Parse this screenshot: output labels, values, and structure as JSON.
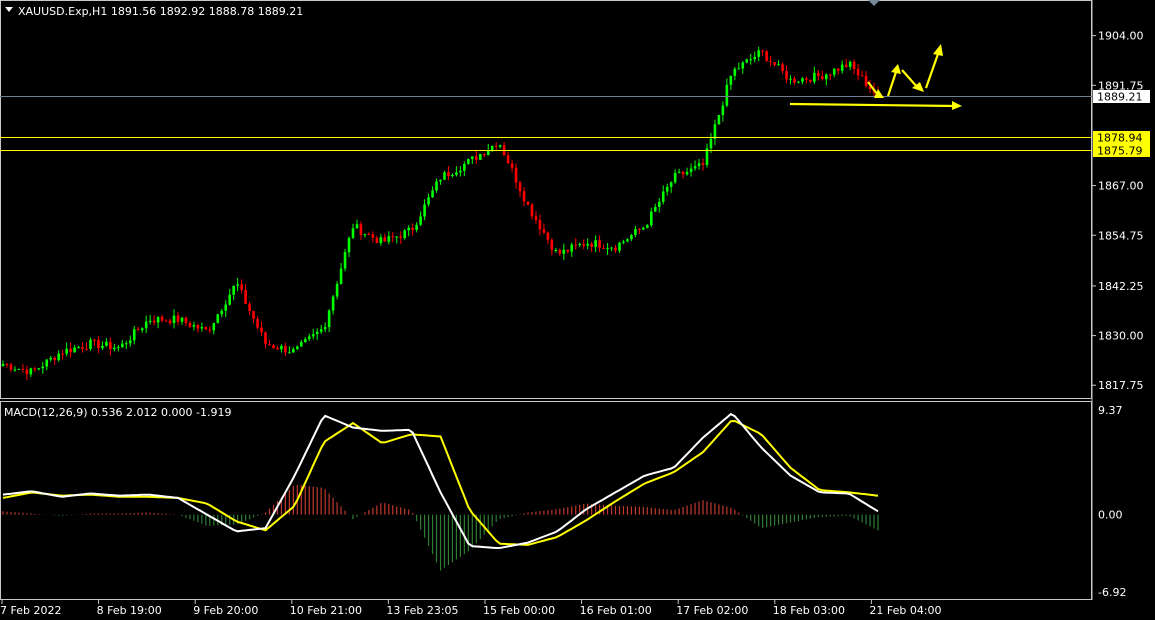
{
  "header": {
    "symbol_line": "XAUUSD.Exp,H1  1891.56 1892.92 1888.78 1889.21",
    "menu_icon": "triangle-down-icon"
  },
  "colors": {
    "background": "#000000",
    "bull": "#00ff00",
    "bear": "#ff0000",
    "level_line": "#ffff00",
    "current_price_line": "#708090",
    "signal_line": "#ffff00",
    "macd_line": "#ffffff",
    "hist_positive": "#c0392b",
    "hist_negative": "#2e7d32",
    "arrow": "#ffff00"
  },
  "chart_data": [
    {
      "type": "candlestick",
      "title": "XAUUSD.Exp,H1",
      "ohlc_last": {
        "open": 1891.56,
        "high": 1892.92,
        "low": 1888.78,
        "close": 1889.21
      },
      "price_ticks": [
        "1904.00",
        "1891.75",
        "1867.00",
        "1854.75",
        "1842.25",
        "1830.00",
        "1817.75"
      ],
      "ylim": [
        1814.6,
        1912.3
      ],
      "levels": [
        {
          "label": "1889.21",
          "value": 1889.21,
          "kind": "current"
        },
        {
          "label": "1878.94",
          "value": 1878.94,
          "kind": "resistance"
        },
        {
          "label": "1875.79",
          "value": 1875.79,
          "kind": "resistance"
        }
      ],
      "x_labels": [
        "7 Feb 2022",
        "8 Feb 19:00",
        "9 Feb 20:00",
        "10 Feb 21:00",
        "13 Feb 23:05",
        "15 Feb 00:00",
        "16 Feb 01:00",
        "17 Feb 02:00",
        "18 Feb 03:00",
        "21 Feb 04:00"
      ],
      "closes_sampled": [
        1823,
        1821,
        1826,
        1828,
        1827,
        1834,
        1834,
        1831,
        1843,
        1828,
        1826,
        1832,
        1857,
        1853,
        1856,
        1869,
        1873,
        1878,
        1862,
        1850,
        1853,
        1852,
        1857,
        1869,
        1872,
        1895,
        1900,
        1893,
        1894,
        1897,
        1889
      ],
      "annotations": "projection arrows drawn in yellow"
    },
    {
      "type": "line",
      "title": "MACD(12,26,9) 0.536 2.012 0.000 -1.919",
      "ticks": [
        "9.37",
        "0.00",
        "-6.92"
      ],
      "ylim": [
        -6.92,
        9.37
      ],
      "series": [
        {
          "name": "MACD",
          "values": [
            1.8,
            2.1,
            1.6,
            1.9,
            1.7,
            1.8,
            1.5,
            0.0,
            -1.5,
            -1.2,
            3.5,
            8.9,
            7.8,
            7.5,
            7.6,
            2.0,
            -2.8,
            -3.0,
            -2.5,
            -1.5,
            0.5,
            2.0,
            3.5,
            4.2,
            6.9,
            9.1,
            6.0,
            3.5,
            2.0,
            1.9,
            0.3
          ]
        },
        {
          "name": "Signal",
          "values": [
            1.5,
            2.0,
            1.7,
            1.8,
            1.6,
            1.6,
            1.5,
            1.0,
            -0.6,
            -1.4,
            0.8,
            6.5,
            8.2,
            6.4,
            7.2,
            7.0,
            0.4,
            -2.6,
            -2.7,
            -2.0,
            -0.5,
            1.2,
            2.8,
            3.8,
            5.6,
            8.5,
            7.2,
            4.2,
            2.2,
            2.0,
            1.7
          ]
        },
        {
          "name": "Histogram",
          "values": [
            0.3,
            0.1,
            -0.1,
            0.1,
            0.1,
            0.2,
            0.0,
            -1.0,
            -0.9,
            0.2,
            2.7,
            2.4,
            -0.4,
            1.1,
            0.4,
            -5.0,
            -3.2,
            -0.4,
            0.2,
            0.5,
            1.0,
            0.8,
            0.7,
            0.4,
            1.3,
            0.6,
            -1.2,
            -0.7,
            -0.2,
            -0.1,
            -1.4
          ]
        }
      ]
    }
  ]
}
